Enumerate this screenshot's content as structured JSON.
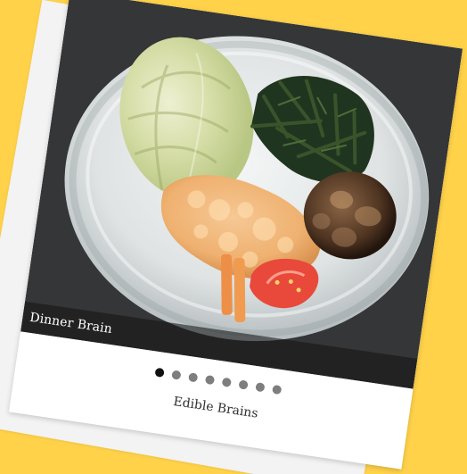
{
  "gallery": {
    "caption": "Dinner Brain",
    "title": "Edible Brains",
    "slides": [
      {
        "label": "Slide 1",
        "active": true
      },
      {
        "label": "Slide 2",
        "active": false
      },
      {
        "label": "Slide 3",
        "active": false
      },
      {
        "label": "Slide 4",
        "active": false
      },
      {
        "label": "Slide 5",
        "active": false
      },
      {
        "label": "Slide 6",
        "active": false
      },
      {
        "label": "Slide 7",
        "active": false
      },
      {
        "label": "Slide 8",
        "active": false
      }
    ],
    "colors": {
      "background": "#ffd24a",
      "card": "#ffffff",
      "active_dot": "#111111",
      "inactive_dot": "#707070"
    }
  }
}
